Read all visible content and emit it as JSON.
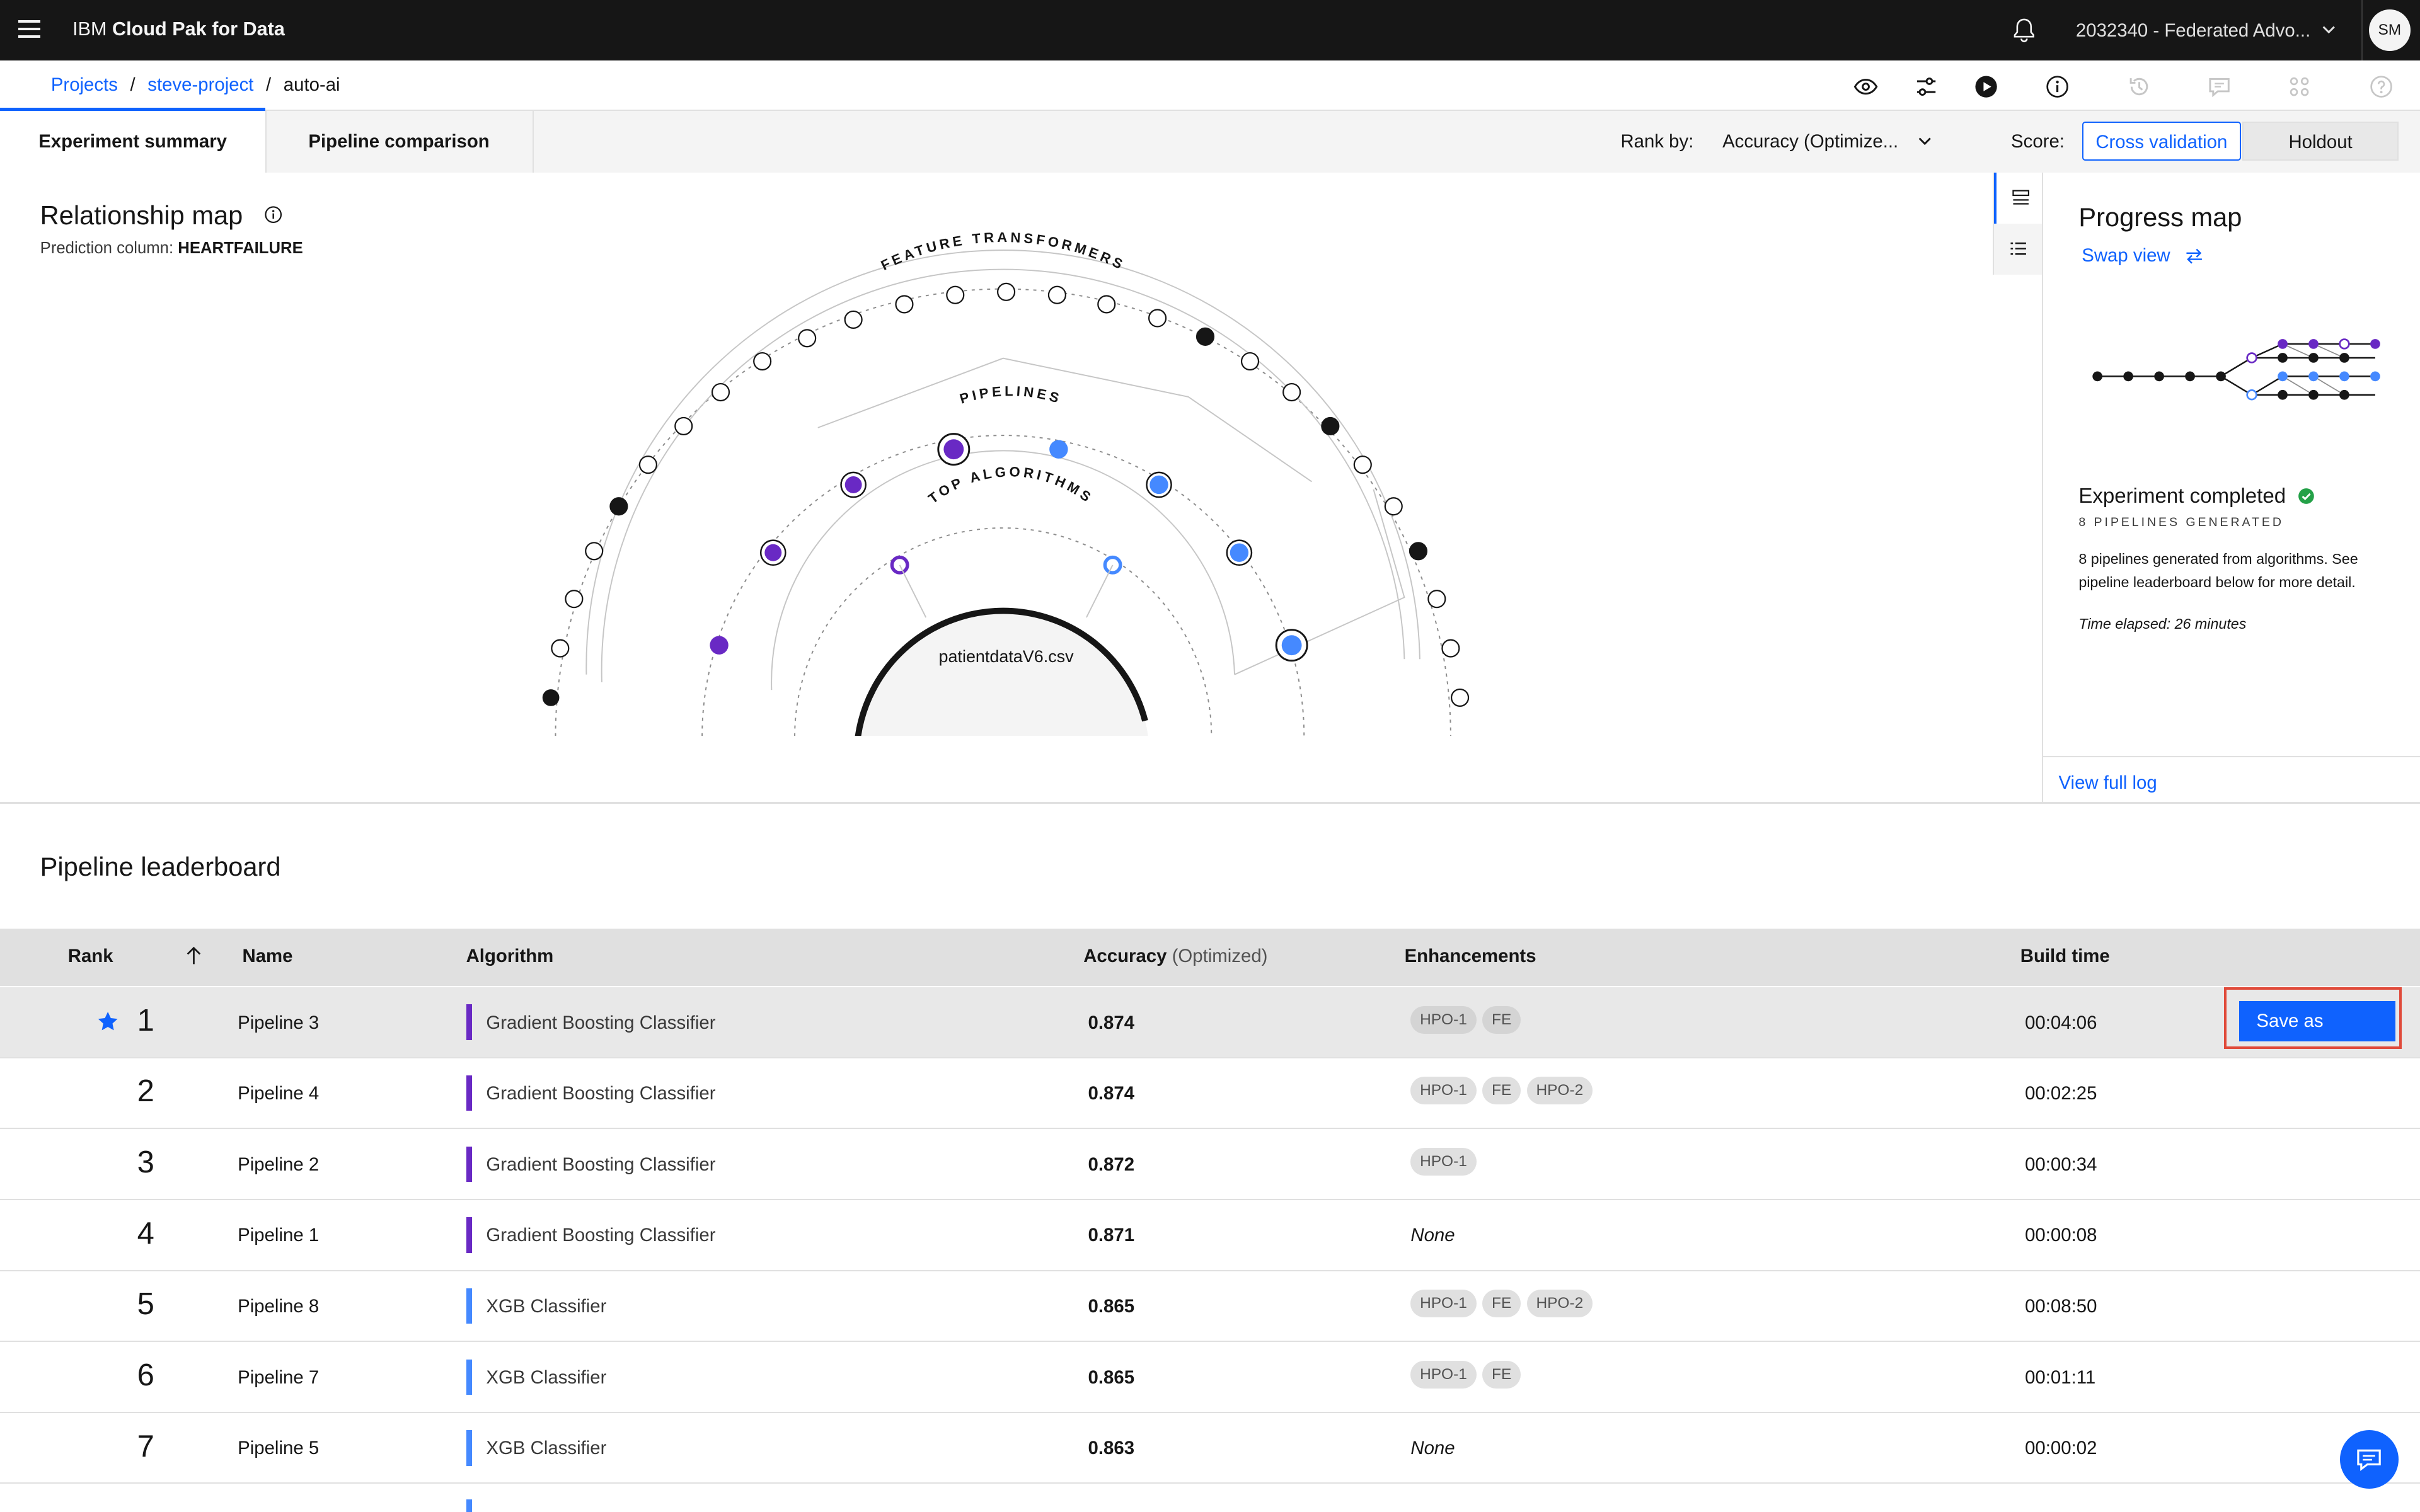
{
  "header": {
    "brand_prefix": "IBM ",
    "brand_name": "Cloud Pak for Data",
    "account": "2032340 - Federated Advo...",
    "avatar_initials": "SM"
  },
  "breadcrumb": {
    "items": [
      "Projects",
      "steve-project",
      "auto-ai"
    ],
    "separator": "/"
  },
  "toolbar_icons": [
    "view-icon",
    "settings-sliders-icon",
    "run-icon",
    "info-icon",
    "history-icon",
    "comment-icon",
    "apps-icon",
    "help-icon"
  ],
  "tabs": [
    {
      "label": "Experiment summary",
      "active": true
    },
    {
      "label": "Pipeline comparison",
      "active": false
    }
  ],
  "rank_by": {
    "label": "Rank by:",
    "value": "Accuracy (Optimize..."
  },
  "score": {
    "label": "Score:",
    "options": [
      "Cross validation",
      "Holdout"
    ],
    "selected": "Cross validation"
  },
  "relationship_map": {
    "title": "Relationship map",
    "prediction_label": "Prediction column:",
    "prediction_value": "HEARTFAILURE",
    "ring_labels": [
      "FEATURE TRANSFORMERS",
      "PIPELINES",
      "TOP ALGORITHMS"
    ],
    "center_file": "patientdataV6.csv"
  },
  "progress_map": {
    "title": "Progress map",
    "swap_view": "Swap view",
    "status_title": "Experiment completed",
    "pipelines_generated": "8 PIPELINES GENERATED",
    "description": "8 pipelines generated from algorithms. See pipeline leaderboard below for more detail.",
    "time_elapsed": "Time elapsed: 26 minutes",
    "view_full_log": "View full log"
  },
  "leaderboard": {
    "title": "Pipeline leaderboard",
    "columns": {
      "rank": "Rank",
      "name": "Name",
      "algorithm": "Algorithm",
      "accuracy": "Accuracy",
      "accuracy_note": "(Optimized)",
      "enhancements": "Enhancements",
      "build_time": "Build time"
    },
    "save_as_label": "Save as",
    "colors": {
      "gradient_boosting": "#6929c4",
      "xgb": "#4589ff"
    },
    "rows": [
      {
        "rank": "1",
        "name": "Pipeline 3",
        "algorithm": "Gradient Boosting Classifier",
        "accuracy": "0.874",
        "enhancements": [
          "HPO-1",
          "FE"
        ],
        "build_time": "00:04:06"
      },
      {
        "rank": "2",
        "name": "Pipeline 4",
        "algorithm": "Gradient Boosting Classifier",
        "accuracy": "0.874",
        "enhancements": [
          "HPO-1",
          "FE",
          "HPO-2"
        ],
        "build_time": "00:02:25"
      },
      {
        "rank": "3",
        "name": "Pipeline 2",
        "algorithm": "Gradient Boosting Classifier",
        "accuracy": "0.872",
        "enhancements": [
          "HPO-1"
        ],
        "build_time": "00:00:34"
      },
      {
        "rank": "4",
        "name": "Pipeline 1",
        "algorithm": "Gradient Boosting Classifier",
        "accuracy": "0.871",
        "enhancements_text": "None",
        "build_time": "00:00:08"
      },
      {
        "rank": "5",
        "name": "Pipeline 8",
        "algorithm": "XGB Classifier",
        "accuracy": "0.865",
        "enhancements": [
          "HPO-1",
          "FE",
          "HPO-2"
        ],
        "build_time": "00:08:50"
      },
      {
        "rank": "6",
        "name": "Pipeline 7",
        "algorithm": "XGB Classifier",
        "accuracy": "0.865",
        "enhancements": [
          "HPO-1",
          "FE"
        ],
        "build_time": "00:01:11"
      },
      {
        "rank": "7",
        "name": "Pipeline 5",
        "algorithm": "XGB Classifier",
        "accuracy": "0.863",
        "enhancements_text": "None",
        "build_time": "00:00:02"
      }
    ]
  }
}
